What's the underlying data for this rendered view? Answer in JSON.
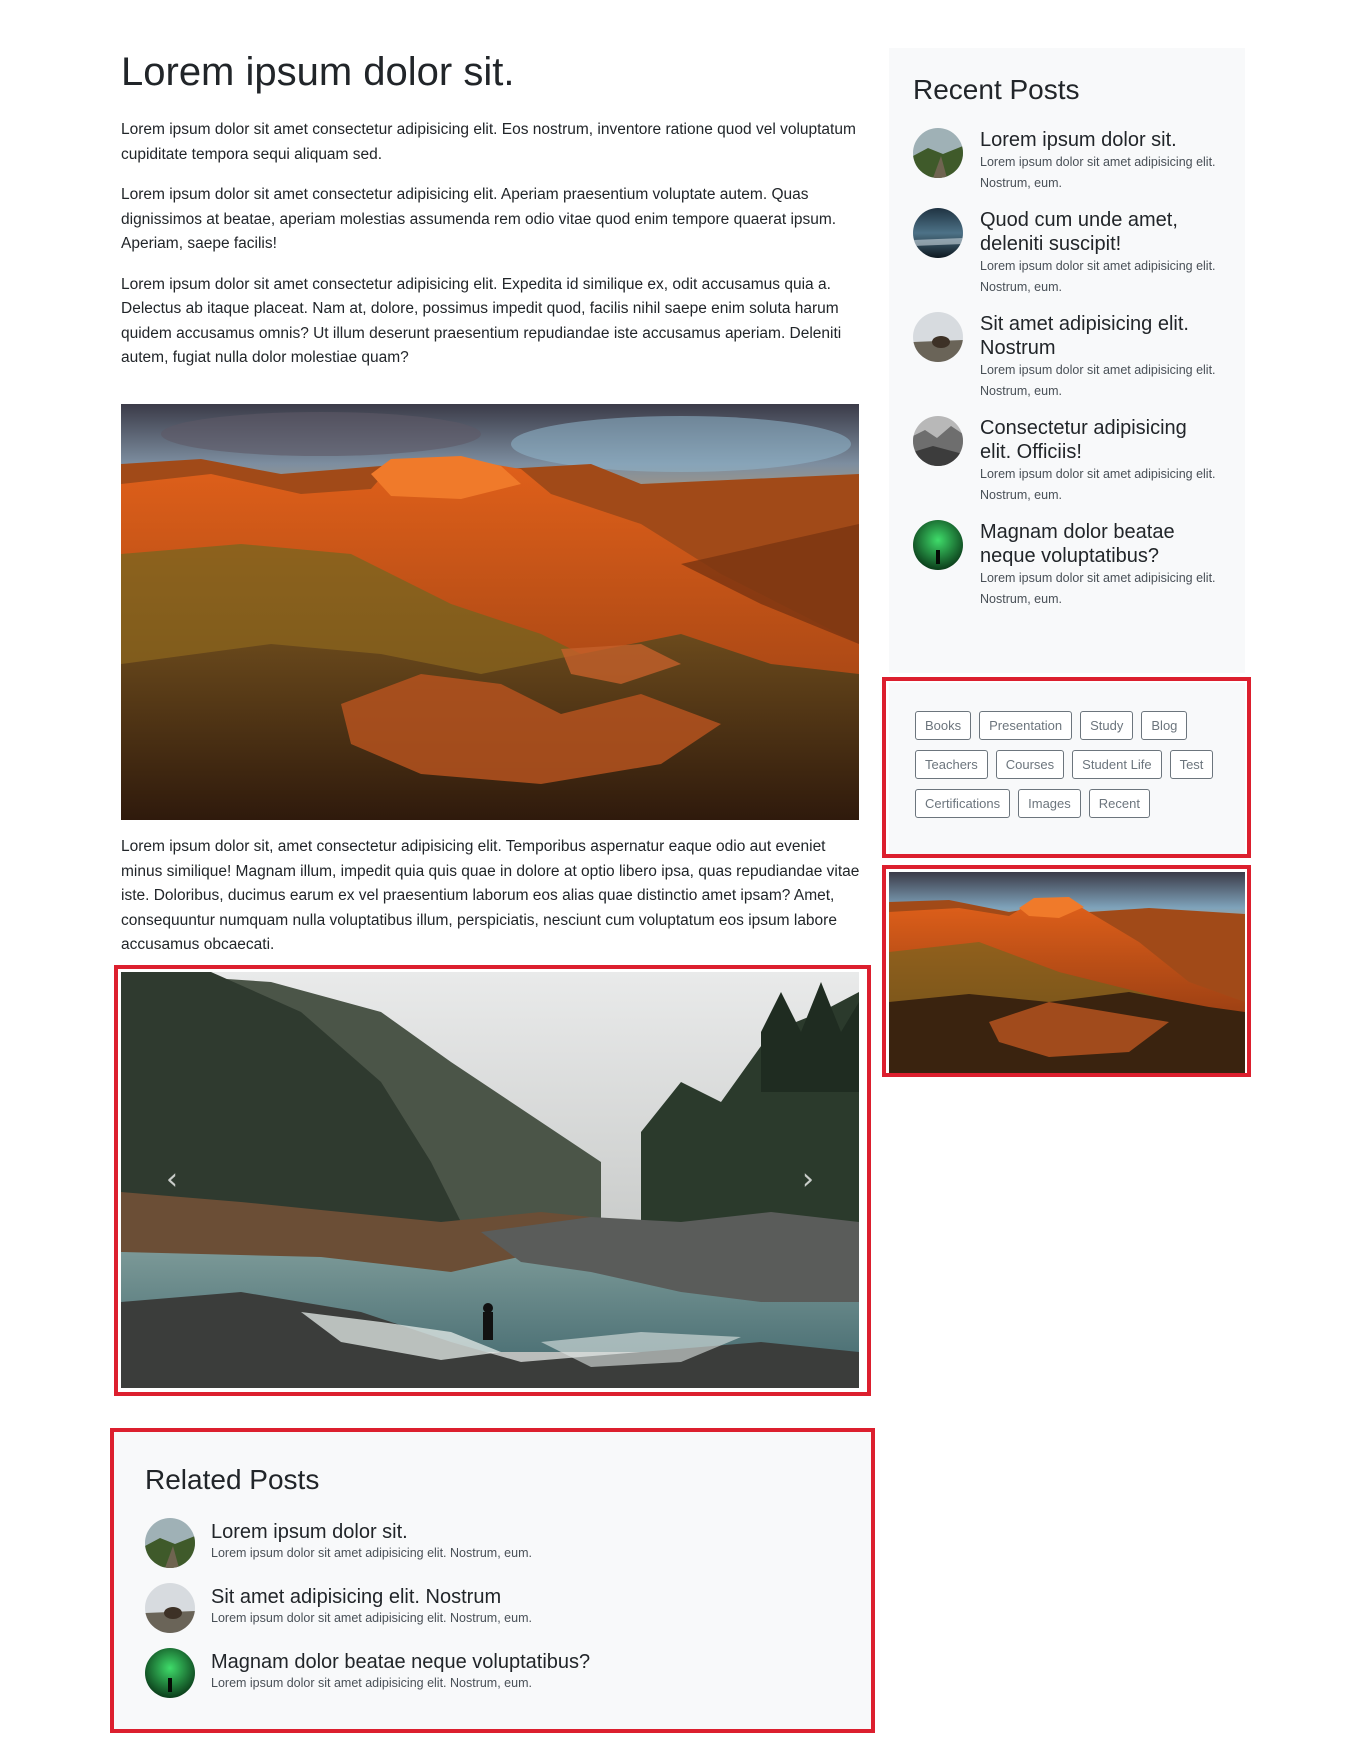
{
  "article": {
    "title": "Lorem ipsum dolor sit.",
    "paragraphs": [
      "Lorem ipsum dolor sit amet consectetur adipisicing elit. Eos nostrum, inventore ratione quod vel voluptatum cupiditate tempora sequi aliquam sed.",
      "Lorem ipsum dolor sit amet consectetur adipisicing elit. Aperiam praesentium voluptate autem. Quas dignissimos at beatae, aperiam molestias assumenda rem odio vitae quod enim tempore quaerat ipsum. Aperiam, saepe facilis!",
      "Lorem ipsum dolor sit amet consectetur adipisicing elit. Expedita id similique ex, odit accusamus quia a. Delectus ab itaque placeat. Nam at, dolore, possimus impedit quod, facilis nihil saepe enim soluta harum quidem accusamus omnis? Ut illum deserunt praesentium repudiandae iste accusamus aperiam. Deleniti autem, fugiat nulla dolor molestiae quam?"
    ],
    "after_image_paragraph": "Lorem ipsum dolor sit, amet consectetur adipisicing elit. Temporibus aspernatur eaque odio aut eveniet minus similique! Magnam illum, impedit quia quis quae in dolore at optio libero ipsa, quas repudiandae vitae iste. Doloribus, ducimus earum ex vel praesentium laborum eos alias quae distinctio amet ipsam? Amet, consequuntur numquam nulla voluptatibus illum, perspiciatis, nesciunt cum voluptatum eos ipsum labore accusamus obcaecati.",
    "images": {
      "main": "canyon-sunset-photo",
      "carousel": "forest-river-photo"
    },
    "carousel": {
      "prev_icon": "chevron-left-icon",
      "next_icon": "chevron-right-icon",
      "prev_glyph": "‹",
      "next_glyph": "›"
    }
  },
  "related_posts": {
    "heading": "Related Posts",
    "items": [
      {
        "title": "Lorem ipsum dolor sit.",
        "excerpt": "Lorem ipsum dolor sit amet adipisicing elit. Nostrum, eum.",
        "thumb": "valley"
      },
      {
        "title": "Sit amet adipisicing elit. Nostrum",
        "excerpt": "Lorem ipsum dolor sit amet adipisicing elit. Nostrum, eum.",
        "thumb": "bear"
      },
      {
        "title": "Magnam dolor beatae neque voluptatibus?",
        "excerpt": "Lorem ipsum dolor sit amet adipisicing elit. Nostrum, eum.",
        "thumb": "aurora"
      }
    ]
  },
  "recent_posts": {
    "heading": "Recent Posts",
    "items": [
      {
        "title": "Lorem ipsum dolor sit.",
        "excerpt": "Lorem ipsum dolor sit amet adipisicing elit. Nostrum, eum.",
        "thumb": "valley"
      },
      {
        "title": "Quod cum unde amet, deleniti suscipit!",
        "excerpt": "Lorem ipsum dolor sit amet adipisicing elit. Nostrum, eum.",
        "thumb": "storm"
      },
      {
        "title": "Sit amet adipisicing elit. Nostrum",
        "excerpt": "Lorem ipsum dolor sit amet adipisicing elit. Nostrum, eum.",
        "thumb": "bear"
      },
      {
        "title": "Consectetur adipisicing elit. Officiis!",
        "excerpt": "Lorem ipsum dolor sit amet adipisicing elit. Nostrum, eum.",
        "thumb": "mono"
      },
      {
        "title": "Magnam dolor beatae neque voluptatibus?",
        "excerpt": "Lorem ipsum dolor sit amet adipisicing elit. Nostrum, eum.",
        "thumb": "aurora"
      }
    ]
  },
  "tags": [
    "Books",
    "Presentation",
    "Study",
    "Blog",
    "Teachers",
    "Courses",
    "Student Life",
    "Test",
    "Certifications",
    "Images",
    "Recent"
  ],
  "colors": {
    "highlight_border": "#dc1f2e",
    "panel_bg": "#f8f9fa",
    "tag_border": "#6c757d"
  }
}
